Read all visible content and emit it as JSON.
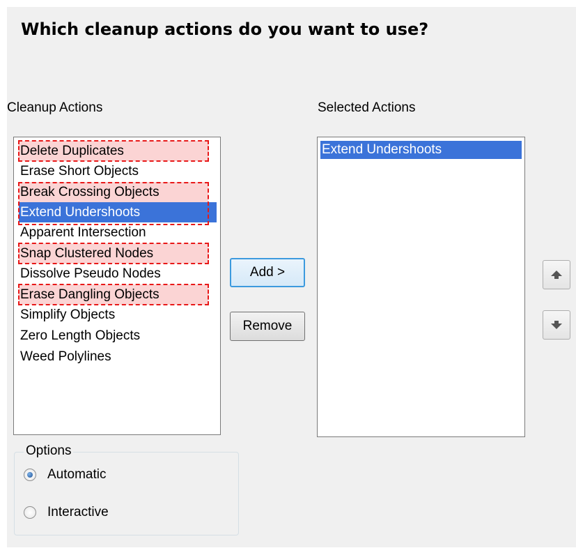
{
  "heading": "Which cleanup actions do you want to use?",
  "cleanup_actions": {
    "label": "Cleanup Actions",
    "items": [
      {
        "label": "Delete Duplicates",
        "highlighted": true,
        "selected": false
      },
      {
        "label": "Erase Short Objects",
        "highlighted": false,
        "selected": false
      },
      {
        "label": "Break Crossing Objects",
        "highlighted": true,
        "selected": false
      },
      {
        "label": "Extend Undershoots",
        "highlighted": true,
        "selected": true
      },
      {
        "label": "Apparent Intersection",
        "highlighted": false,
        "selected": false
      },
      {
        "label": "Snap Clustered Nodes",
        "highlighted": true,
        "selected": false
      },
      {
        "label": "Dissolve Pseudo Nodes",
        "highlighted": false,
        "selected": false
      },
      {
        "label": "Erase Dangling Objects",
        "highlighted": true,
        "selected": false
      },
      {
        "label": "Simplify Objects",
        "highlighted": false,
        "selected": false
      },
      {
        "label": "Zero Length Objects",
        "highlighted": false,
        "selected": false
      },
      {
        "label": "Weed Polylines",
        "highlighted": false,
        "selected": false
      }
    ]
  },
  "selected_actions": {
    "label": "Selected Actions",
    "items": [
      {
        "label": "Extend Undershoots",
        "selected": true
      }
    ]
  },
  "buttons": {
    "add": "Add >",
    "remove": "Remove",
    "move_up_icon": "arrow-up-icon",
    "move_down_icon": "arrow-down-icon"
  },
  "options": {
    "title": "Options",
    "choices": [
      {
        "label": "Automatic",
        "checked": true
      },
      {
        "label": "Interactive",
        "checked": false
      }
    ]
  },
  "colors": {
    "selection": "#3b73d9",
    "highlight_fill": "#fbd4d4",
    "highlight_border": "#e81818",
    "panel_bg": "#f0f0f0"
  }
}
